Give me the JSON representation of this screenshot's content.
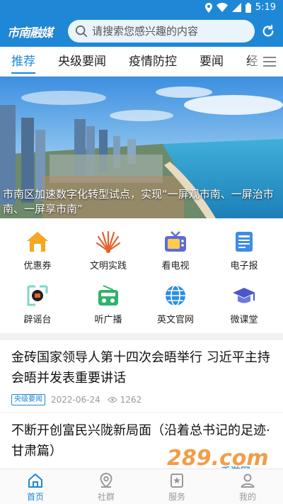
{
  "status_bar": {
    "time": "5:19"
  },
  "header": {
    "logo_text": "市南融媒",
    "search_placeholder": "请搜索您感兴趣的内容"
  },
  "tabs": [
    {
      "label": "推荐",
      "active": true
    },
    {
      "label": "央级要闻",
      "active": false
    },
    {
      "label": "疫情防控",
      "active": false
    },
    {
      "label": "要闻",
      "active": false
    },
    {
      "label": "经",
      "active": false
    }
  ],
  "banner": {
    "caption": "市南区加速数字化转型试点，实现“一屏观市南、一屏治市南、一屏享市南”"
  },
  "grid": [
    {
      "label": "优惠券",
      "icon": "coupon-house-icon"
    },
    {
      "label": "文明实践",
      "icon": "civilization-fan-icon"
    },
    {
      "label": "看电视",
      "icon": "tv-icon"
    },
    {
      "label": "电子报",
      "icon": "newspaper-icon"
    },
    {
      "label": "辟谣台",
      "icon": "rumor-refute-icon"
    },
    {
      "label": "听广播",
      "icon": "radio-icon"
    },
    {
      "label": "英文官网",
      "icon": "globe-icon"
    },
    {
      "label": "微课堂",
      "icon": "graduation-cap-icon"
    }
  ],
  "news": [
    {
      "title": "金砖国家领导人第十四次会晤举行 习近平主持会晤并发表重要讲话",
      "tag": "央级要闻",
      "date": "2022-06-24",
      "views": "1262"
    },
    {
      "title": "不断开创富民兴陇新局面（沿着总书记的足迹·甘肃篇）"
    }
  ],
  "watermark": {
    "text": "289.com",
    "subtext": "手游网"
  },
  "bottom_nav": [
    {
      "label": "首页",
      "icon": "home-icon",
      "active": true
    },
    {
      "label": "社群",
      "icon": "location-icon",
      "active": false
    },
    {
      "label": "服务",
      "icon": "service-star-icon",
      "active": false
    },
    {
      "label": "我的",
      "icon": "profile-icon",
      "active": false
    }
  ],
  "colors": {
    "brand": "#1e88d6",
    "text": "#222222",
    "muted": "#999999"
  }
}
